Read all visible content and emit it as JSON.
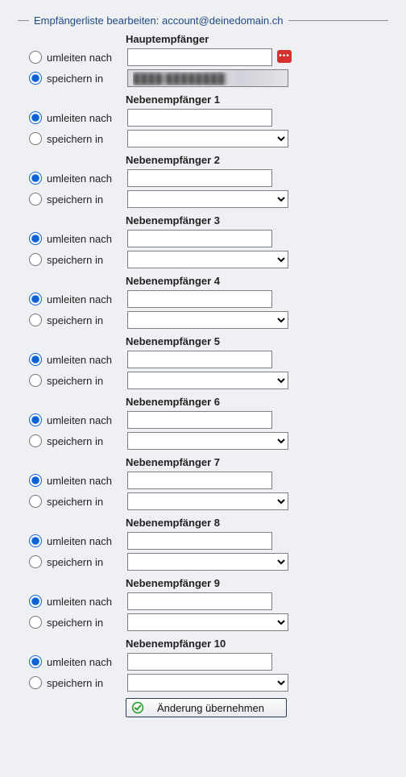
{
  "legend": "Empfängerliste bearbeiten: account@deinedomain.ch",
  "labels": {
    "redirect": "umleiten nach",
    "store": "speichern in"
  },
  "submit_label": "Änderung übernehmen",
  "main": {
    "title": "Hauptempfänger",
    "redirect_selected": false,
    "store_selected": true,
    "redirect_value": "",
    "store_value": "████/████████",
    "has_error": true
  },
  "secondary": [
    {
      "title": "Nebenempfänger 1",
      "redirect_selected": true,
      "store_selected": false,
      "redirect_value": "",
      "store_value": ""
    },
    {
      "title": "Nebenempfänger 2",
      "redirect_selected": true,
      "store_selected": false,
      "redirect_value": "",
      "store_value": ""
    },
    {
      "title": "Nebenempfänger 3",
      "redirect_selected": true,
      "store_selected": false,
      "redirect_value": "",
      "store_value": ""
    },
    {
      "title": "Nebenempfänger 4",
      "redirect_selected": true,
      "store_selected": false,
      "redirect_value": "",
      "store_value": ""
    },
    {
      "title": "Nebenempfänger 5",
      "redirect_selected": true,
      "store_selected": false,
      "redirect_value": "",
      "store_value": ""
    },
    {
      "title": "Nebenempfänger 6",
      "redirect_selected": true,
      "store_selected": false,
      "redirect_value": "",
      "store_value": ""
    },
    {
      "title": "Nebenempfänger 7",
      "redirect_selected": true,
      "store_selected": false,
      "redirect_value": "",
      "store_value": ""
    },
    {
      "title": "Nebenempfänger 8",
      "redirect_selected": true,
      "store_selected": false,
      "redirect_value": "",
      "store_value": ""
    },
    {
      "title": "Nebenempfänger 9",
      "redirect_selected": true,
      "store_selected": false,
      "redirect_value": "",
      "store_value": ""
    },
    {
      "title": "Nebenempfänger 10",
      "redirect_selected": true,
      "store_selected": false,
      "redirect_value": "",
      "store_value": ""
    }
  ]
}
